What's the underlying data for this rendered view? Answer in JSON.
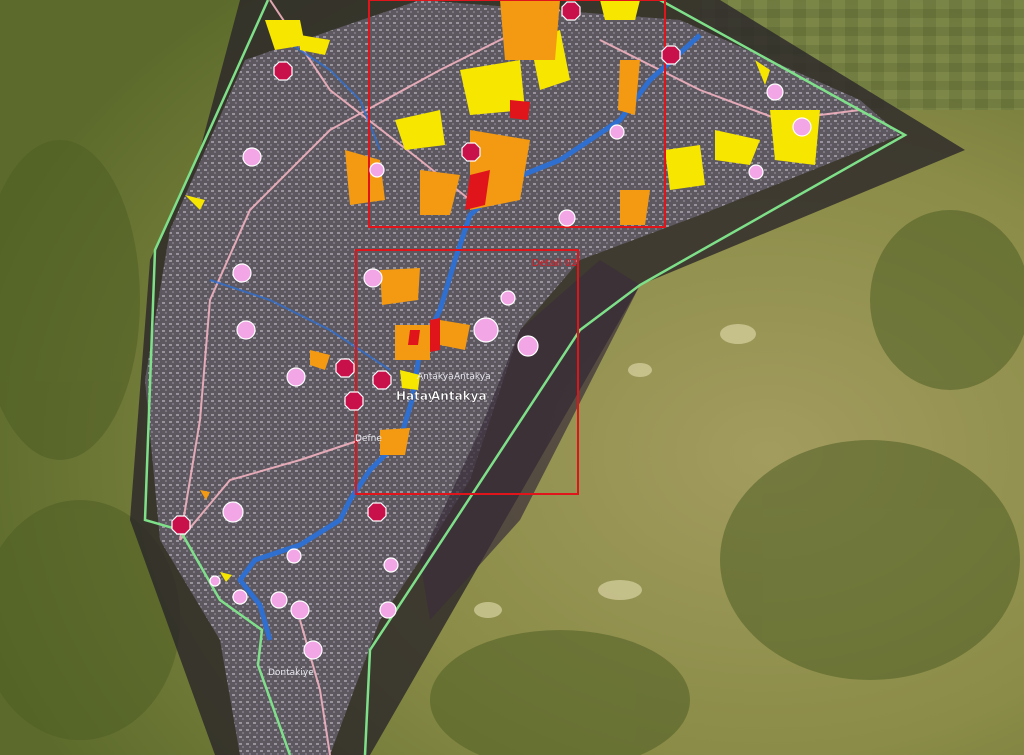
{
  "map": {
    "labels": {
      "detail": "Detail 02",
      "antakya_small_1": "Antakya",
      "antakya_small_2": "Antakya",
      "hatay": "Hatay",
      "antakya_main": "Antakya",
      "defne": "Defne",
      "dontakiye": "Dontakiye"
    },
    "colors": {
      "boundary": "#7fe08a",
      "detail_frame": "#e0151b",
      "river": "#2f6fd0",
      "road": "#f2b3c0",
      "damage_destroyed": "#e0151b",
      "damage_severe": "#f39a12",
      "damage_moderate": "#f6e600",
      "hospital_marker": "#c8104a",
      "shelter_marker": "#f2a6e6"
    }
  }
}
